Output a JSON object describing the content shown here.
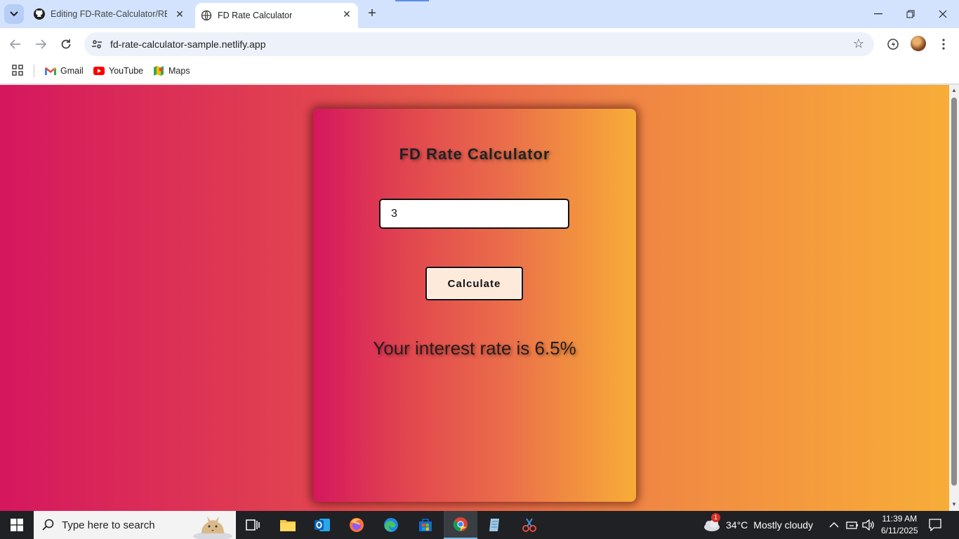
{
  "browser": {
    "tabs": [
      {
        "title": "Editing FD-Rate-Calculator/README",
        "favicon": "github-icon"
      },
      {
        "title": "FD Rate Calculator",
        "favicon": "globe-icon",
        "active": true
      }
    ],
    "url": "fd-rate-calculator-sample.netlify.app",
    "bookmarks": [
      {
        "label": "Gmail",
        "icon": "gmail-icon"
      },
      {
        "label": "YouTube",
        "icon": "youtube-icon"
      },
      {
        "label": "Maps",
        "icon": "maps-icon"
      }
    ]
  },
  "app": {
    "title": "FD Rate Calculator",
    "input_value": "3",
    "button_label": "Calculate",
    "result": "Your interest rate is 6.5%",
    "colors": {
      "gradient_start": "#d5175e",
      "gradient_end": "#f8ad38",
      "button_bg": "#fdeadb"
    }
  },
  "taskbar": {
    "search_placeholder": "Type here to search",
    "weather": {
      "temp": "34°C",
      "condition": "Mostly cloudy",
      "badge": "1"
    },
    "time": "11:39 AM",
    "date": "6/11/2025"
  }
}
